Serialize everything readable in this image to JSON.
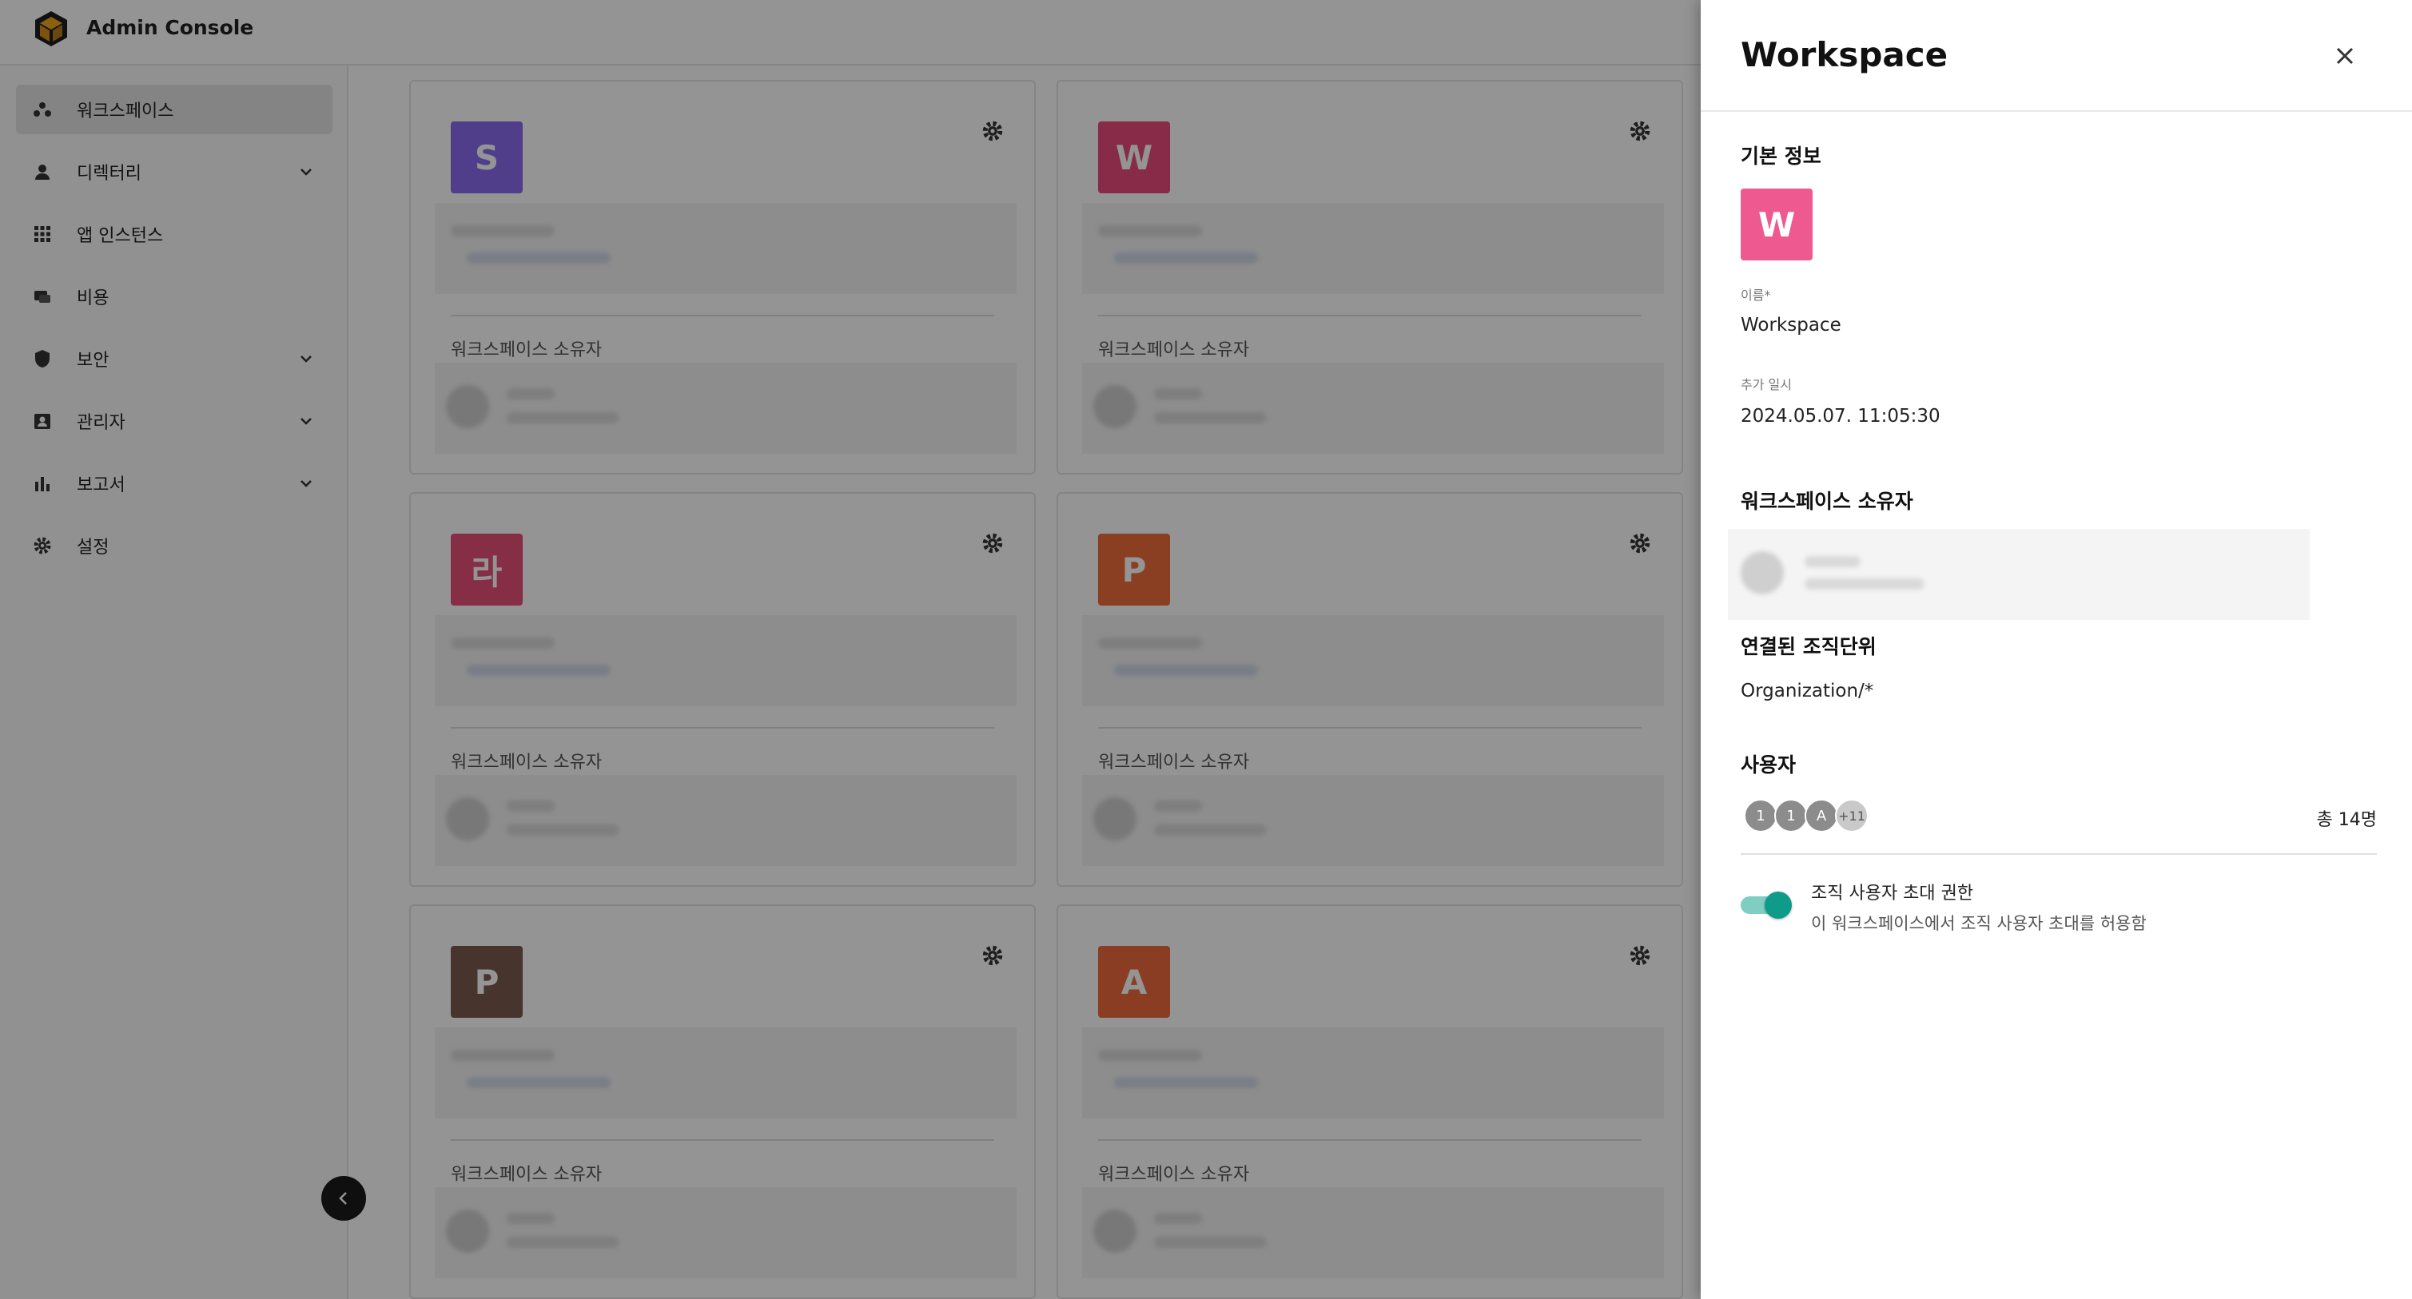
{
  "app": {
    "title": "Admin Console"
  },
  "sidebar": {
    "items": [
      {
        "label": "워크스페이스",
        "icon": "workspace-icon",
        "active": true,
        "expandable": false
      },
      {
        "label": "디렉터리",
        "icon": "person-icon",
        "active": false,
        "expandable": true
      },
      {
        "label": "앱 인스턴스",
        "icon": "apps-grid-icon",
        "active": false,
        "expandable": false
      },
      {
        "label": "비용",
        "icon": "billing-icon",
        "active": false,
        "expandable": false
      },
      {
        "label": "보안",
        "icon": "shield-icon",
        "active": false,
        "expandable": true
      },
      {
        "label": "관리자",
        "icon": "admin-badge-icon",
        "active": false,
        "expandable": true
      },
      {
        "label": "보고서",
        "icon": "bar-chart-icon",
        "active": false,
        "expandable": true
      },
      {
        "label": "설정",
        "icon": "gear-icon",
        "active": false,
        "expandable": false
      }
    ]
  },
  "cards": [
    {
      "initial": "S",
      "color": "#8a6cf0",
      "owner_label": "워크스페이스 소유자"
    },
    {
      "initial": "W",
      "color": "#e94a7e",
      "owner_label": "워크스페이스 소유자"
    },
    {
      "initial": "라",
      "color": "#e8507a",
      "owner_label": "워크스페이스 소유자"
    },
    {
      "initial": "P",
      "color": "#ee6b3c",
      "owner_label": "워크스페이스 소유자"
    },
    {
      "initial": "P",
      "color": "#7a5a4e",
      "owner_label": "워크스페이스 소유자"
    },
    {
      "initial": "A",
      "color": "#ee6a3c",
      "owner_label": "워크스페이스 소유자"
    }
  ],
  "drawer": {
    "title": "Workspace",
    "basic_info_title": "기본 정보",
    "avatar_initial": "W",
    "name_label": "이름",
    "required_mark": "*",
    "name_value": "Workspace",
    "added_label": "추가 일시",
    "added_value": "2024.05.07. 11:05:30",
    "owner_title": "워크스페이스 소유자",
    "org_title": "연결된 조직단위",
    "org_value": "Organization/*",
    "users_title": "사용자",
    "user_avatars": [
      "1",
      "1",
      "A",
      "+11"
    ],
    "users_total": "총 14명",
    "invite_permission_title": "조직 사용자 초대 권한",
    "invite_permission_desc": "이 워크스페이스에서 조직 사용자 초대를 허용함",
    "invite_permission_enabled": true,
    "accent_color": "#0f9b8a"
  }
}
